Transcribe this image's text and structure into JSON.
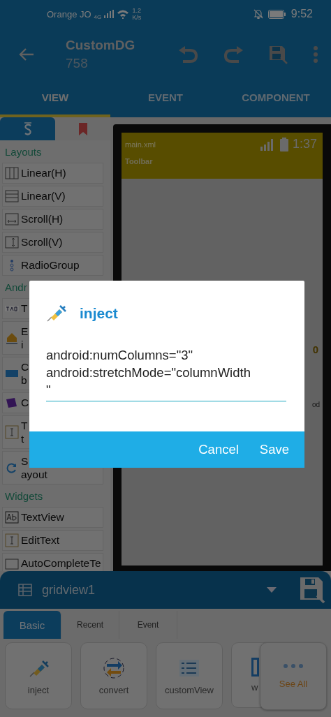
{
  "status_bar": {
    "carrier": "Orange JO",
    "network": "4G",
    "speed": [
      "1.2",
      "K/s"
    ],
    "time": "9:52"
  },
  "app_bar": {
    "title": "CustomDG",
    "subtitle": "758"
  },
  "tabs": [
    {
      "label": "VIEW",
      "selected": true
    },
    {
      "label": "EVENT",
      "selected": false
    },
    {
      "label": "COMPONENT",
      "selected": false
    }
  ],
  "palette": {
    "tabs": [
      {
        "kind": "components",
        "selected": true
      },
      {
        "kind": "bookmark",
        "selected": false
      }
    ],
    "sections": [
      {
        "title": "Layouts",
        "items": [
          {
            "lines": [
              "Linear(H)"
            ]
          },
          {
            "lines": [
              "Linear(V)"
            ]
          },
          {
            "lines": [
              "Scroll(H)"
            ]
          },
          {
            "lines": [
              "Scroll(V)"
            ]
          },
          {
            "lines": [
              "RadioGroup"
            ]
          }
        ]
      },
      {
        "title": "Andr",
        "items": [
          {
            "lines": [
              "T"
            ]
          },
          {
            "lines": [
              "E",
              "i"
            ]
          },
          {
            "lines": [
              "C",
              "b"
            ]
          },
          {
            "lines": [
              "C"
            ]
          },
          {
            "lines": [
              "T",
              "t"
            ]
          },
          {
            "lines": [
              "S",
              "ayout"
            ]
          }
        ]
      },
      {
        "title": "Widgets",
        "items": [
          {
            "lines": [
              "TextView"
            ]
          },
          {
            "lines": [
              "EditText"
            ]
          },
          {
            "lines": [
              "AutoCompleteTe"
            ]
          }
        ]
      }
    ]
  },
  "canvas": {
    "file": "main.xml",
    "time": "1:37",
    "toolbar": "Toolbar",
    "fragments": [
      "0",
      "od"
    ]
  },
  "dialog": {
    "title": "inject",
    "value": "android:numColumns=\"3\"\nandroid:stretchMode=\"columnWidth\n\"",
    "buttons": [
      "Cancel",
      "Save"
    ]
  },
  "bottom_panel": {
    "widget": "gridview1",
    "tabs": [
      {
        "label": "Basic",
        "selected": true
      },
      {
        "label": "Recent",
        "selected": false
      },
      {
        "label": "Event",
        "selected": false
      }
    ],
    "tiles": [
      {
        "label": "inject"
      },
      {
        "label": "convert"
      },
      {
        "label": "customView"
      },
      {
        "label": "w"
      }
    ],
    "see_all": "See All"
  }
}
